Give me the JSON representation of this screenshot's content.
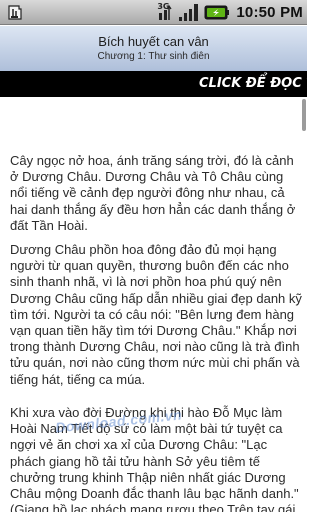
{
  "status_bar": {
    "network_label": "3G",
    "time": "10:50 PM",
    "icons": [
      "usb-debugging-icon",
      "3g-network-icon",
      "signal-strength-icon",
      "battery-charging-icon"
    ]
  },
  "header": {
    "book_title": "Bích huyết can vân",
    "chapter_title": "Chương 1: Thư sinh điên"
  },
  "banner": {
    "text": "CLICK ĐỂ ĐỌC TH"
  },
  "content": {
    "paragraphs": [
      "Cây ngọc nở hoa, ánh trăng sáng trời, đó là cảnh ở Dương Châu. Dương Châu và Tô Châu cùng nổi tiếng về cảnh đẹp người đông như nhau, cả hai danh thắng ấy đều hơn hẳn các danh thắng ở đất Tần Hoài.",
      "Dương Châu phồn hoa đông đảo đủ mọi hạng người từ quan quyền, thương buôn đến các nho sinh thanh nhã, vì là nơi phồn hoa phú quý nên Dương Châu cũng hấp dẫn nhiều giai đẹp danh kỹ tìm tới. Người ta có câu nói: \"Bên lưng đem hàng vạn quan tiền hãy tìm tới Dương Châu.\" Khắp nơi trong thành Dương Châu, nơi nào cũng là trà đình tửu quán, nơi nào cũng thơm nức mùi chi phấn và tiếng hát, tiếng ca múa.",
      "Khi xưa vào đời Đường khi thi hào Đỗ Mục làm Hoài Nam Tiết độ sứ có làm một bài tứ tuyệt ca ngợi vẻ ăn chơi xa xỉ của Dương Châu: \"Lạc phách giang hồ tải tửu hành Sở yêu tiêm tế chưởng trung khinh Thập niên nhất giác Dương Châu mộng Doanh đắc thanh lâu bạc hãnh danh.\" (Giang hồ lạc phách mang rượu theo Trên tay gái Sở nhẹ nhàng như"
    ],
    "watermark": "Download.com.vn"
  }
}
